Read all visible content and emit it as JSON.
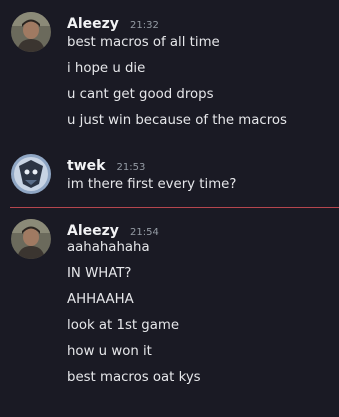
{
  "groups": [
    {
      "author": "Aleezy",
      "time": "21:32",
      "messages": [
        "best macros of all time",
        "i hope u die",
        "u cant get good drops",
        "u just win because of the macros"
      ]
    },
    {
      "author": "twek",
      "time": "21:53",
      "messages": [
        "im there first every time?"
      ]
    },
    {
      "author": "Aleezy",
      "time": "21:54",
      "messages": [
        "aahahahaha",
        "IN WHAT?",
        "AHHAAHA",
        "look at 1st game",
        "how u won it",
        "best macros oat kys"
      ]
    }
  ],
  "colors": {
    "background": "#1a1a24",
    "username": "#f2f3f5",
    "timestamp": "#949ba4",
    "message": "#e6e7ea",
    "new_divider": "#b5464e"
  }
}
